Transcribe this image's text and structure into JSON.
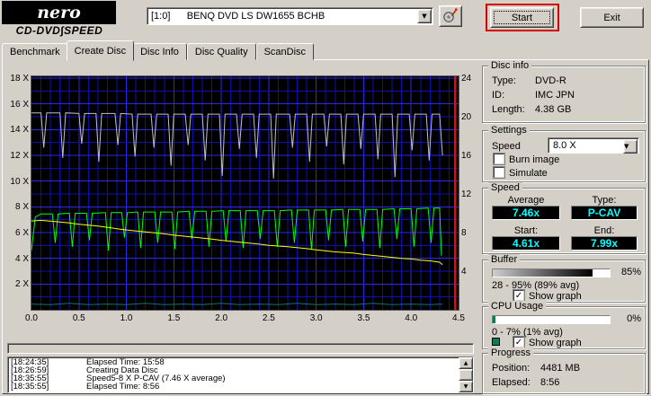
{
  "logo": {
    "brand": "nero",
    "subtitle": "CD-DVD∫SPEED"
  },
  "toolbar": {
    "drive_combo": "[1:0]      BENQ DVD LS DW1655 BCHB",
    "start_label": "Start",
    "exit_label": "Exit"
  },
  "tabs": [
    {
      "label": "Benchmark",
      "active": false
    },
    {
      "label": "Create Disc",
      "active": true
    },
    {
      "label": "Disc Info",
      "active": false
    },
    {
      "label": "Disc Quality",
      "active": false
    },
    {
      "label": "ScanDisc",
      "active": false
    }
  ],
  "chart_data": {
    "type": "line",
    "title": "",
    "x_unit": "GB",
    "x_range": [
      0,
      4.5
    ],
    "left_axis": {
      "range": [
        0,
        18
      ],
      "ticks": [
        {
          "v": 18,
          "label": "18 X"
        },
        {
          "v": 16,
          "label": "16 X"
        },
        {
          "v": 14,
          "label": "14 X"
        },
        {
          "v": 12,
          "label": "12 X"
        },
        {
          "v": 10,
          "label": "10 X"
        },
        {
          "v": 8,
          "label": "8 X"
        },
        {
          "v": 6,
          "label": "6 X"
        },
        {
          "v": 4,
          "label": "4 X"
        },
        {
          "v": 2,
          "label": "2 X"
        }
      ]
    },
    "right_axis": {
      "range": [
        0,
        24
      ],
      "ticks": [
        {
          "v": 24,
          "label": "24"
        },
        {
          "v": 20,
          "label": "20"
        },
        {
          "v": 16,
          "label": "16"
        },
        {
          "v": 12,
          "label": "12"
        },
        {
          "v": 8,
          "label": "8"
        },
        {
          "v": 4,
          "label": "4"
        }
      ]
    },
    "x_ticks": [
      {
        "v": 0,
        "label": "0.0"
      },
      {
        "v": 0.5,
        "label": "0.5"
      },
      {
        "v": 1,
        "label": "1.0"
      },
      {
        "v": 1.5,
        "label": "1.5"
      },
      {
        "v": 2,
        "label": "2.0"
      },
      {
        "v": 2.5,
        "label": "2.5"
      },
      {
        "v": 3,
        "label": "3.0"
      },
      {
        "v": 3.5,
        "label": "3.5"
      },
      {
        "v": 4,
        "label": "4.0"
      },
      {
        "v": 4.5,
        "label": "4.5"
      }
    ],
    "bg": "#000000",
    "grid_color": "#0f0fae",
    "grid_major_color": "#2a2ae2",
    "marker_x": 4.46,
    "marker_color": "#ff0000",
    "series": [
      {
        "name": "buffer-level",
        "color": "#c0c0c0",
        "points": [
          [
            0.0,
            15.3
          ],
          [
            0.1,
            15.3
          ],
          [
            0.13,
            12.6
          ],
          [
            0.16,
            15.3
          ],
          [
            0.3,
            15.3
          ],
          [
            0.33,
            11.8
          ],
          [
            0.36,
            15.3
          ],
          [
            0.5,
            15.25
          ],
          [
            0.53,
            12.9
          ],
          [
            0.56,
            15.25
          ],
          [
            0.68,
            15.25
          ],
          [
            0.71,
            11.5
          ],
          [
            0.74,
            15.25
          ],
          [
            0.88,
            15.25
          ],
          [
            0.91,
            12.8
          ],
          [
            0.94,
            15.25
          ],
          [
            1.06,
            15.2
          ],
          [
            1.09,
            11.9
          ],
          [
            1.12,
            15.2
          ],
          [
            1.26,
            15.2
          ],
          [
            1.29,
            12.6
          ],
          [
            1.32,
            15.2
          ],
          [
            1.44,
            15.2
          ],
          [
            1.47,
            11.2
          ],
          [
            1.5,
            15.2
          ],
          [
            1.62,
            15.2
          ],
          [
            1.65,
            12.8
          ],
          [
            1.68,
            15.2
          ],
          [
            1.8,
            15.2
          ],
          [
            1.83,
            11.6
          ],
          [
            1.86,
            15.2
          ],
          [
            1.98,
            15.2
          ],
          [
            2.01,
            10.4
          ],
          [
            2.04,
            15.2
          ],
          [
            2.16,
            15.2
          ],
          [
            2.19,
            12.5
          ],
          [
            2.22,
            15.2
          ],
          [
            2.34,
            15.2
          ],
          [
            2.37,
            11.8
          ],
          [
            2.4,
            15.2
          ],
          [
            2.52,
            15.2
          ],
          [
            2.55,
            10.2
          ],
          [
            2.58,
            15.2
          ],
          [
            2.72,
            15.2
          ],
          [
            2.75,
            12.6
          ],
          [
            2.78,
            15.2
          ],
          [
            2.9,
            15.2
          ],
          [
            2.93,
            11.5
          ],
          [
            2.96,
            15.2
          ],
          [
            3.08,
            15.2
          ],
          [
            3.11,
            12.7
          ],
          [
            3.14,
            15.2
          ],
          [
            3.26,
            15.2
          ],
          [
            3.29,
            11.3
          ],
          [
            3.32,
            15.2
          ],
          [
            3.44,
            15.2
          ],
          [
            3.47,
            12.5
          ],
          [
            3.5,
            15.2
          ],
          [
            3.62,
            15.2
          ],
          [
            3.65,
            11.7
          ],
          [
            3.68,
            15.2
          ],
          [
            3.8,
            15.2
          ],
          [
            3.83,
            10.3
          ],
          [
            3.86,
            15.2
          ],
          [
            3.98,
            15.2
          ],
          [
            4.01,
            12.4
          ],
          [
            4.04,
            15.2
          ],
          [
            4.16,
            15.2
          ],
          [
            4.19,
            11.6
          ],
          [
            4.22,
            15.2
          ],
          [
            4.3,
            15.2
          ],
          [
            4.33,
            12.0
          ]
        ]
      },
      {
        "name": "write-speed",
        "color": "#00ff00",
        "points": [
          [
            0.0,
            4.6
          ],
          [
            0.04,
            7.2
          ],
          [
            0.1,
            7.45
          ],
          [
            0.22,
            7.45
          ],
          [
            0.25,
            5.2
          ],
          [
            0.28,
            7.45
          ],
          [
            0.4,
            7.5
          ],
          [
            0.43,
            4.9
          ],
          [
            0.46,
            7.5
          ],
          [
            0.58,
            7.5
          ],
          [
            0.61,
            5.4
          ],
          [
            0.64,
            7.5
          ],
          [
            0.78,
            7.55
          ],
          [
            0.81,
            4.6
          ],
          [
            0.84,
            7.55
          ],
          [
            0.95,
            7.55
          ],
          [
            0.98,
            5.6
          ],
          [
            1.01,
            7.55
          ],
          [
            1.12,
            7.6
          ],
          [
            1.15,
            4.8
          ],
          [
            1.18,
            7.6
          ],
          [
            1.3,
            7.6
          ],
          [
            1.33,
            5.2
          ],
          [
            1.36,
            7.6
          ],
          [
            1.48,
            7.6
          ],
          [
            1.51,
            4.7
          ],
          [
            1.54,
            7.6
          ],
          [
            1.66,
            7.65
          ],
          [
            1.69,
            5.5
          ],
          [
            1.72,
            7.65
          ],
          [
            1.84,
            7.65
          ],
          [
            1.87,
            4.9
          ],
          [
            1.9,
            7.65
          ],
          [
            2.02,
            7.7
          ],
          [
            2.05,
            5.3
          ],
          [
            2.08,
            7.7
          ],
          [
            2.2,
            7.7
          ],
          [
            2.23,
            4.8
          ],
          [
            2.26,
            7.7
          ],
          [
            2.38,
            7.7
          ],
          [
            2.41,
            5.5
          ],
          [
            2.44,
            7.7
          ],
          [
            2.56,
            7.7
          ],
          [
            2.59,
            4.9
          ],
          [
            2.62,
            7.7
          ],
          [
            2.74,
            7.75
          ],
          [
            2.77,
            5.2
          ],
          [
            2.8,
            7.75
          ],
          [
            2.92,
            7.75
          ],
          [
            2.95,
            4.7
          ],
          [
            2.98,
            7.75
          ],
          [
            3.1,
            7.75
          ],
          [
            3.13,
            5.4
          ],
          [
            3.16,
            7.75
          ],
          [
            3.28,
            7.8
          ],
          [
            3.31,
            4.9
          ],
          [
            3.34,
            7.8
          ],
          [
            3.46,
            7.8
          ],
          [
            3.49,
            5.3
          ],
          [
            3.52,
            7.8
          ],
          [
            3.64,
            7.8
          ],
          [
            3.67,
            4.8
          ],
          [
            3.7,
            7.8
          ],
          [
            3.82,
            7.85
          ],
          [
            3.85,
            5.5
          ],
          [
            3.88,
            7.85
          ],
          [
            4.0,
            7.85
          ],
          [
            4.03,
            4.9
          ],
          [
            4.06,
            7.85
          ],
          [
            4.18,
            7.9
          ],
          [
            4.21,
            5.2
          ],
          [
            4.24,
            7.9
          ],
          [
            4.3,
            7.9
          ],
          [
            4.32,
            4.2
          ]
        ]
      },
      {
        "name": "speed-trend",
        "color": "#ffff00",
        "points": [
          [
            0.0,
            6.9
          ],
          [
            0.1,
            6.95
          ],
          [
            0.25,
            6.85
          ],
          [
            0.4,
            6.75
          ],
          [
            0.5,
            6.65
          ],
          [
            0.7,
            6.5
          ],
          [
            0.9,
            6.3
          ],
          [
            1.0,
            6.2
          ],
          [
            1.2,
            6.05
          ],
          [
            1.4,
            5.9
          ],
          [
            1.5,
            5.8
          ],
          [
            1.7,
            5.65
          ],
          [
            1.9,
            5.5
          ],
          [
            2.0,
            5.4
          ],
          [
            2.2,
            5.25
          ],
          [
            2.4,
            5.1
          ],
          [
            2.5,
            5.0
          ],
          [
            2.7,
            4.9
          ],
          [
            2.9,
            4.75
          ],
          [
            3.0,
            4.65
          ],
          [
            3.2,
            4.5
          ],
          [
            3.4,
            4.4
          ],
          [
            3.5,
            4.3
          ],
          [
            3.7,
            4.15
          ],
          [
            3.9,
            4.0
          ],
          [
            4.0,
            3.95
          ],
          [
            4.1,
            3.85
          ],
          [
            4.2,
            3.8
          ],
          [
            4.3,
            3.7
          ],
          [
            4.33,
            3.5
          ]
        ]
      },
      {
        "name": "cpu-usage",
        "color": "#0e7a5a",
        "points": [
          [
            0.0,
            0.45
          ],
          [
            0.2,
            0.4
          ],
          [
            0.4,
            0.5
          ],
          [
            0.6,
            0.4
          ],
          [
            0.8,
            0.45
          ],
          [
            1.0,
            0.4
          ],
          [
            1.2,
            0.5
          ],
          [
            1.4,
            0.4
          ],
          [
            1.6,
            0.45
          ],
          [
            1.8,
            0.4
          ],
          [
            2.0,
            0.5
          ],
          [
            2.2,
            0.4
          ],
          [
            2.4,
            0.45
          ],
          [
            2.6,
            0.4
          ],
          [
            2.8,
            0.5
          ],
          [
            3.0,
            0.4
          ],
          [
            3.2,
            0.45
          ],
          [
            3.4,
            0.4
          ],
          [
            3.6,
            0.5
          ],
          [
            3.8,
            0.4
          ],
          [
            4.0,
            0.45
          ],
          [
            4.2,
            0.4
          ],
          [
            4.33,
            0.45
          ]
        ]
      }
    ]
  },
  "sidebar": {
    "disc_info": {
      "title": "Disc info",
      "rows": [
        {
          "label": "Type:",
          "value": "DVD-R"
        },
        {
          "label": "ID:",
          "value": "IMC JPN"
        },
        {
          "label": "Length:",
          "value": "4.38 GB"
        }
      ]
    },
    "settings": {
      "title": "Settings",
      "speed_label": "Speed",
      "speed_value": "8.0 X",
      "options": [
        {
          "label": "Burn image",
          "checked": false
        },
        {
          "label": "Simulate",
          "checked": false
        }
      ]
    },
    "speed": {
      "title": "Speed",
      "average_label": "Average",
      "average_value": "7.46x",
      "type_label": "Type:",
      "type_value": "P-CAV",
      "start_label": "Start:",
      "start_value": "4.61x",
      "end_label": "End:",
      "end_value": "7.99x",
      "lcd_color": "#00ffff"
    },
    "buffer": {
      "title": "Buffer",
      "percent_label": "85%",
      "fill_percent": 85,
      "range_text": "28 - 95% (89% avg)",
      "show_graph_label": "Show graph",
      "show_graph_checked": true
    },
    "cpu": {
      "title": "CPU Usage",
      "percent_label": "0%",
      "fill_percent": 2,
      "range_text": "0 - 7% (1% avg)",
      "show_graph_label": "Show graph",
      "show_graph_checked": true,
      "legend_color": "#0e7a5a"
    },
    "progress": {
      "title": "Progress",
      "rows": [
        {
          "label": "Position:",
          "value": "4481 MB"
        },
        {
          "label": "Elapsed:",
          "value": "8:56"
        }
      ]
    }
  },
  "log": [
    {
      "time": "[18:24:35]",
      "text": "Elapsed Time: 15:58"
    },
    {
      "time": "[18:26:59]",
      "text": "Creating Data Disc"
    },
    {
      "time": "[18:35:55]",
      "text": "Speed5-8 X P-CAV (7.46 X average)"
    },
    {
      "time": "[18:35:55]",
      "text": "Elapsed Time: 8:56"
    }
  ]
}
